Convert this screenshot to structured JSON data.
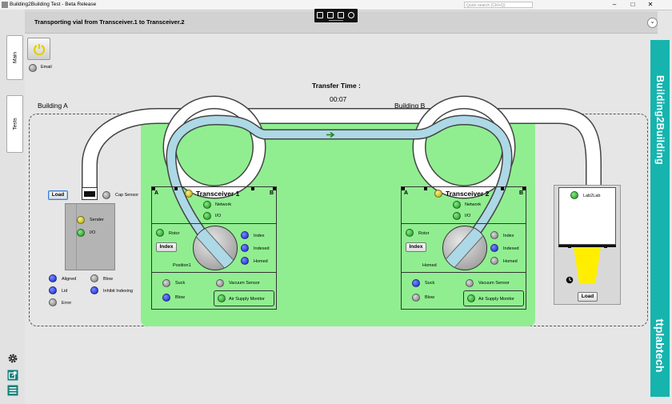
{
  "window": {
    "title": "Building2Building Test - Beta Release",
    "search_placeholder": "Quick search (Ctrl+Q)",
    "minimize": "–",
    "maximize": "□",
    "close": "✕"
  },
  "status": {
    "message": "Transporting vial from Transceiver.1 to Transceiver.2"
  },
  "sidebar": {
    "tabs": [
      {
        "label": "Main"
      },
      {
        "label": "Tests"
      }
    ]
  },
  "power": {
    "email_label": "Email"
  },
  "transfer": {
    "label": "Transfer Time :",
    "value": "00:07"
  },
  "buildings": {
    "a": "Building A",
    "b": "Building B"
  },
  "left_station": {
    "load_label": "Load",
    "cap_sensor": "Cap Sensor",
    "sender": "Sender",
    "io": "I/O",
    "aligned": "Aligned",
    "lid": "Lid",
    "error": "Error",
    "blow": "Blow",
    "inhibit": "Inhibit Indexing"
  },
  "transceiver1": {
    "title": "Transceiver 1",
    "a": "A",
    "b": "B",
    "network": "Network",
    "io": "I/O",
    "rotor": "Rotor",
    "index_btn": "Index",
    "index": "Index",
    "indexed": "Indexed",
    "homed": "Homed",
    "position": "Position1",
    "suck": "Suck",
    "blow": "Blow",
    "vacuum": "Vacuum Sensor",
    "air": "Air Supply Monitor"
  },
  "transceiver2": {
    "title": "Transceiver 2",
    "a": "A",
    "b": "B",
    "network": "Network",
    "io": "I/O",
    "rotor": "Rotor",
    "index_btn": "Index",
    "index": "Index",
    "indexed": "Indexed",
    "homed": "Homed",
    "position": "Homed",
    "suck": "Suck",
    "blow": "Blow",
    "vacuum": "Vacuum Sensor",
    "air": "Air Supply Monitor"
  },
  "lab": {
    "label": "Lab2Lab",
    "load_label": "Load"
  },
  "brand": {
    "title": "Building2Building",
    "logo": "ttplabtech"
  },
  "colors": {
    "brand": "#16b4ad",
    "green_area": "#90ee90",
    "tube": "#add8e6",
    "vial": "#ffee00"
  },
  "icons": [
    "power-icon",
    "gear-icon",
    "export-icon",
    "menu-icon",
    "arrow-right-icon",
    "clock-icon"
  ]
}
